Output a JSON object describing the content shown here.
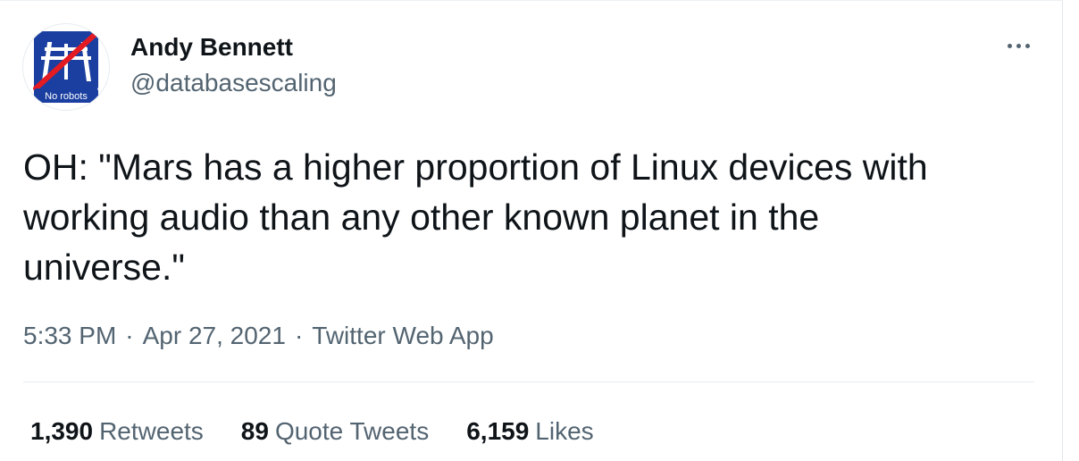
{
  "user": {
    "display_name": "Andy Bennett",
    "handle": "@databasescaling",
    "avatar_caption": "No robots",
    "avatar_icon": "motorway-sign-icon"
  },
  "tweet": {
    "text": "OH: \"Mars has a higher proportion of Linux devices with\nworking audio than any other known planet in the\nuniverse.\""
  },
  "meta": {
    "time": "5:33 PM",
    "separator": "·",
    "date": "Apr 27, 2021",
    "source": "Twitter Web App"
  },
  "stats": [
    {
      "count": "1,390",
      "label": "Retweets"
    },
    {
      "count": "89",
      "label": "Quote Tweets"
    },
    {
      "count": "6,159",
      "label": "Likes"
    }
  ],
  "colors": {
    "avatar_blue": "#1a3fa0",
    "avatar_slash": "#e31b23",
    "secondary_text": "#536471"
  }
}
